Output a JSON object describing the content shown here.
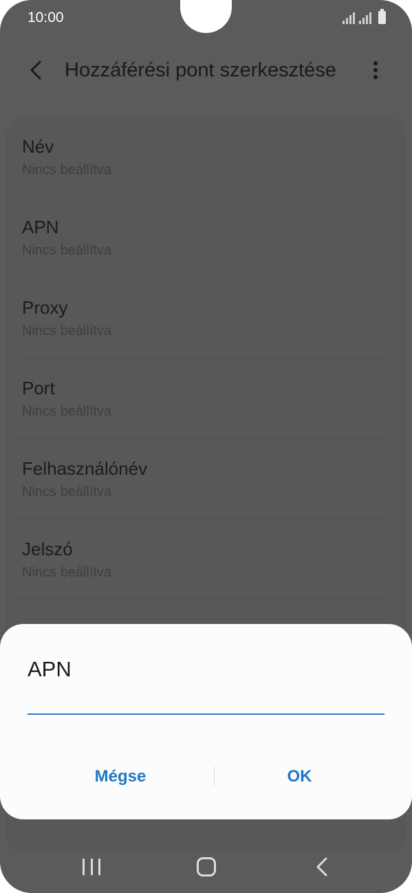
{
  "status_bar": {
    "time": "10:00"
  },
  "header": {
    "title": "Hozzáférési pont szerkesztése"
  },
  "settings": [
    {
      "label": "Név",
      "value": "Nincs beállítva"
    },
    {
      "label": "APN",
      "value": "Nincs beállítva"
    },
    {
      "label": "Proxy",
      "value": "Nincs beállítva"
    },
    {
      "label": "Port",
      "value": "Nincs beállítva"
    },
    {
      "label": "Felhasználónév",
      "value": "Nincs beállítva"
    },
    {
      "label": "Jelszó",
      "value": "Nincs beállítva"
    }
  ],
  "peek_value": "Nincs beállítva",
  "dialog": {
    "title": "APN",
    "input_value": "",
    "cancel_label": "Mégse",
    "ok_label": "OK"
  },
  "colors": {
    "accent": "#1f78c4",
    "dim_background": "#5b5b5b",
    "dialog_background": "#fcfcfc"
  },
  "icons": {
    "back": "back-chevron-icon",
    "more": "more-vertical-icon",
    "nav_recent": "recent-apps-icon",
    "nav_home": "home-icon",
    "nav_back": "nav-back-icon"
  }
}
